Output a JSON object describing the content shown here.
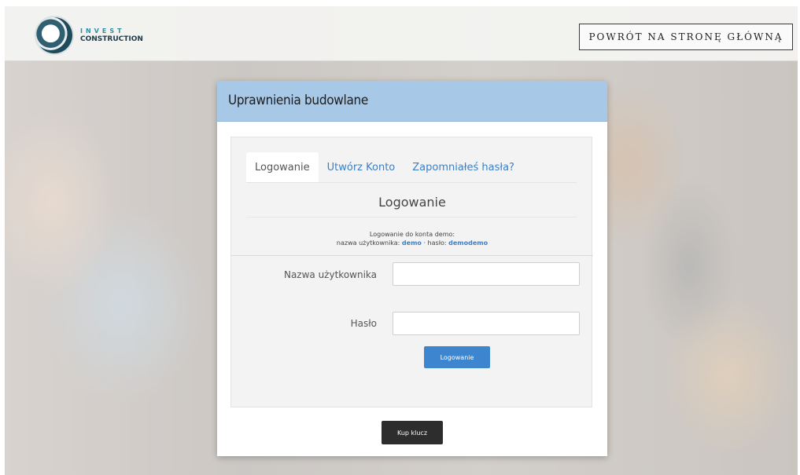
{
  "header": {
    "logo_line1": "INVEST",
    "logo_line2": "CONSTRUCTION",
    "back_button_label": "POWRÓT NA STRONĘ GŁÓWNĄ"
  },
  "modal": {
    "title": "Uprawnienia budowlane",
    "tabs": [
      {
        "label": "Logowanie",
        "active": true
      },
      {
        "label": "Utwórz Konto",
        "active": false
      },
      {
        "label": "Zapomniałeś hasła?",
        "active": false
      }
    ],
    "section_title": "Logowanie",
    "demo": {
      "line1": "Logowanie do konta demo:",
      "username_prefix": "nazwa użytkownika:",
      "username": "demo",
      "separator": "·",
      "password_prefix": "hasło:",
      "password": "demodemo"
    },
    "form": {
      "username_label": "Nazwa użytkownika",
      "username_value": "",
      "password_label": "Hasło",
      "password_value": "",
      "submit_label": "Logowanie"
    },
    "buy_button_label": "Kup klucz"
  },
  "colors": {
    "header_bar": "#a8c8e8",
    "link": "#3d7fc4",
    "primary_button": "#3d86cf",
    "dark_button": "#2d2d2d"
  }
}
